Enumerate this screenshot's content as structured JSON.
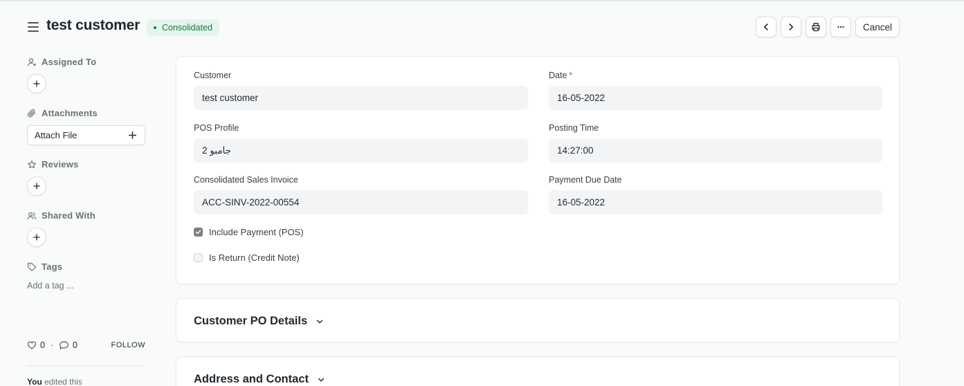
{
  "header": {
    "title": "test customer",
    "status": "Consolidated",
    "status_color": "#16794c",
    "status_bg": "#e4f5e9",
    "buttons": {
      "prev_icon": "chevron-left-icon",
      "next_icon": "chevron-right-icon",
      "print_icon": "printer-icon",
      "more_icon": "more-horizontal-icon",
      "cancel_label": "Cancel"
    }
  },
  "sidebar": {
    "assigned_to": "Assigned To",
    "attachments": "Attachments",
    "attach_file": "Attach File",
    "reviews": "Reviews",
    "shared_with": "Shared With",
    "tags": "Tags",
    "add_tag": "Add a tag ...",
    "likes": "0",
    "separator": "·",
    "comments": "0",
    "follow": "FOLLOW",
    "activity_user": "You",
    "activity_text": " edited this"
  },
  "form": {
    "customer": {
      "label": "Customer",
      "value": "test customer"
    },
    "date": {
      "label": "Date",
      "required": "*",
      "value": "16-05-2022"
    },
    "pos_profile": {
      "label": "POS Profile",
      "value": "جامبو 2"
    },
    "posting_time": {
      "label": "Posting Time",
      "value": "14:27:00"
    },
    "consolidated_invoice": {
      "label": "Consolidated Sales Invoice",
      "value": "ACC-SINV-2022-00554"
    },
    "payment_due_date": {
      "label": "Payment Due Date",
      "value": "16-05-2022"
    },
    "include_payment": {
      "label": "Include Payment (POS)",
      "checked": true
    },
    "is_return": {
      "label": "Is Return (Credit Note)",
      "checked": false
    }
  },
  "sections": [
    {
      "title": "Customer PO Details",
      "collapsed": true
    },
    {
      "title": "Address and Contact",
      "collapsed": true
    }
  ]
}
